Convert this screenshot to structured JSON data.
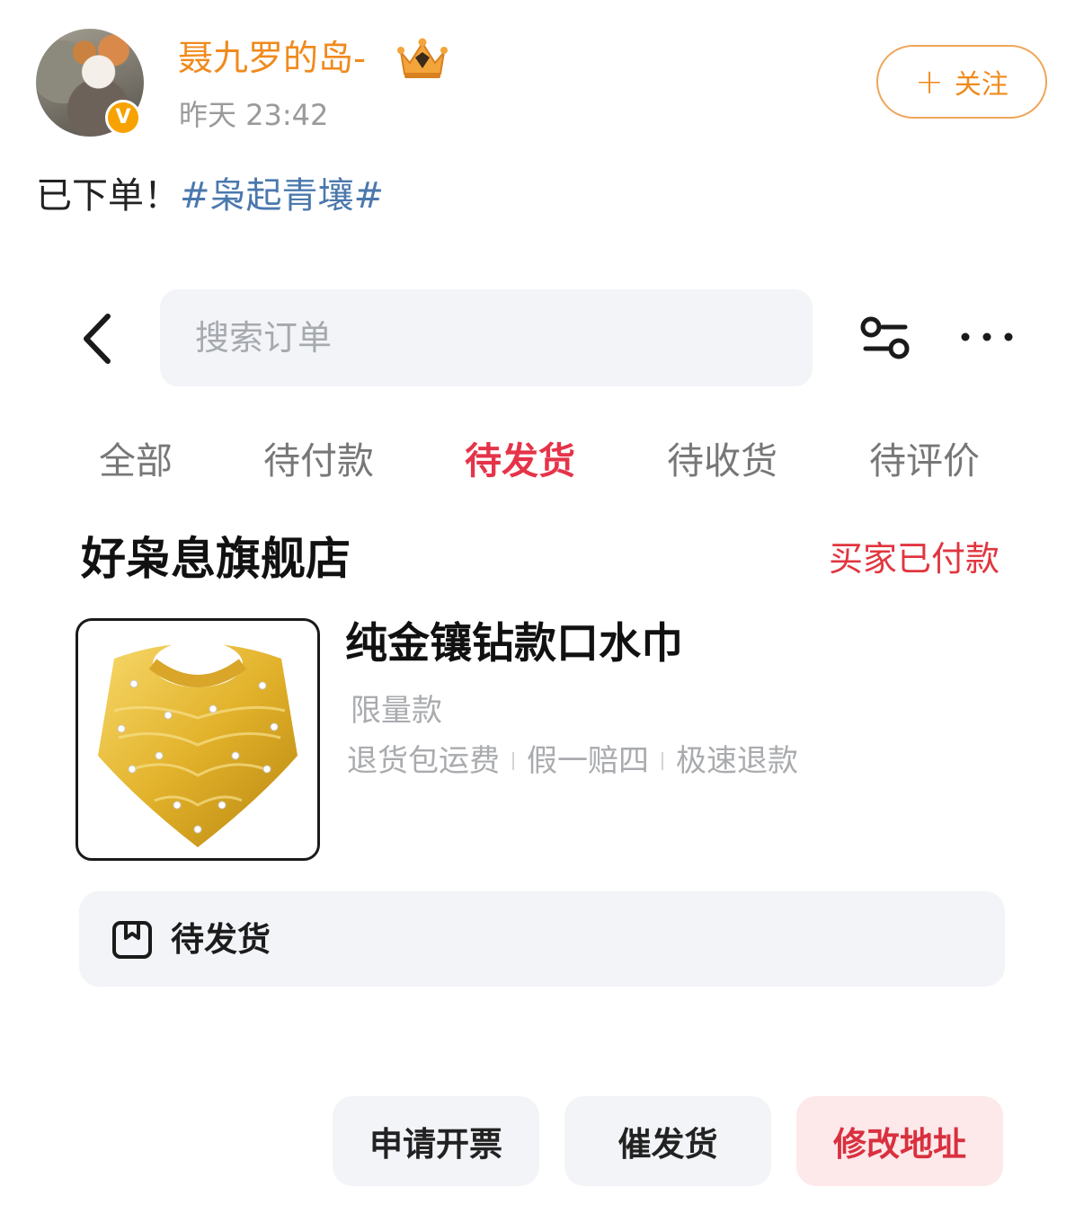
{
  "post": {
    "username": "聂九罗的岛-",
    "timestamp": "昨天 23:42",
    "follow_label": "关注",
    "follow_plus": "+",
    "text_prefix": "已下单！",
    "hashtag": "#枭起青壤#",
    "verified_badge": "V"
  },
  "order_app": {
    "search_placeholder": "搜索订单",
    "tabs": [
      "全部",
      "待付款",
      "待发货",
      "待收货",
      "待评价"
    ],
    "active_tab": "待发货",
    "shop_name": "好枭息旗舰店",
    "order_status": "买家已付款",
    "product": {
      "title": "纯金镶钻款口水巾",
      "variant": "限量款",
      "service_tags": [
        "退货包运费",
        "假一赔四",
        "极速退款"
      ]
    },
    "shipping_status": "待发货",
    "actions": [
      "申请开票",
      "催发货",
      "修改地址"
    ]
  },
  "colors": {
    "username": "#f08a1c",
    "hashtag": "#4a78ad",
    "active_tab": "#e53449",
    "order_status": "#e1363f",
    "primary_action_bg": "#fde8ea"
  },
  "icons": [
    "back-chevron-icon",
    "filter-icon",
    "more-icon",
    "box-icon",
    "crown-icon",
    "verified-icon"
  ]
}
